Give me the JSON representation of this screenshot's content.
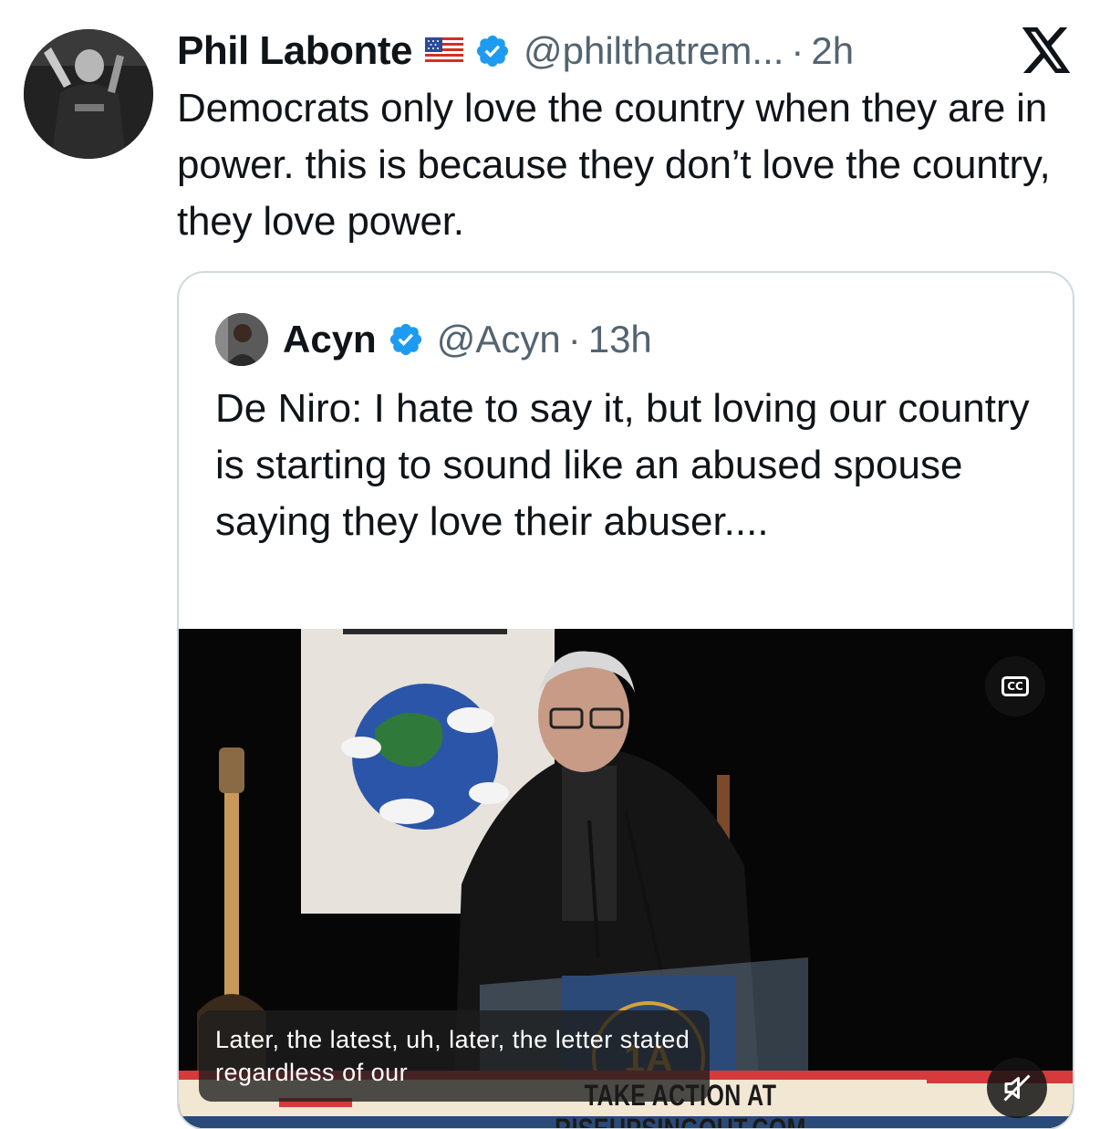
{
  "tweet": {
    "author_name": "Phil Labonte",
    "author_flag": "us-flag-icon",
    "author_handle": "@philthatrem...",
    "separator": "·",
    "time": "2h",
    "text": "Democrats only love the country when they are in power. this is because they don’t love the country, they love power."
  },
  "quoted": {
    "author_name": "Acyn",
    "author_handle": "@Acyn",
    "separator": "·",
    "time": "13h",
    "text": "De Niro: I hate to say it, but loving our country is starting to sound like an abused spouse saying they love their abuser....",
    "video": {
      "caption": "Later, the latest, uh, later, the letter stated regardless of our",
      "banner": "TAKE ACTION AT RISEUPSINGOUT.COM",
      "cc_label": "CC"
    }
  },
  "colors": {
    "verified": "#1d9bf0",
    "secondary_text": "#536471",
    "border": "#cfd9de"
  }
}
